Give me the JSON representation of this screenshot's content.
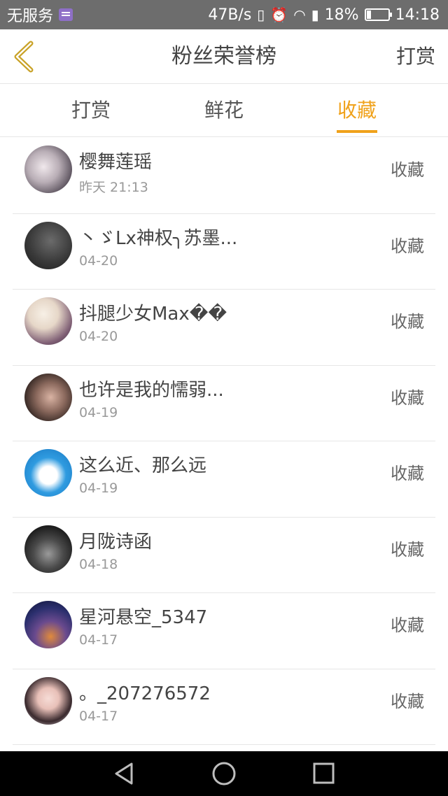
{
  "status_bar": {
    "carrier": "无服务",
    "speed": "47B/s",
    "battery": "18%",
    "time": "14:18"
  },
  "header": {
    "title": "粉丝荣誉榜",
    "right_action": "打赏"
  },
  "tabs": [
    {
      "label": "打赏",
      "active": false
    },
    {
      "label": "鲜花",
      "active": false
    },
    {
      "label": "收藏",
      "active": true
    }
  ],
  "accent_color": "#f0a21b",
  "list": [
    {
      "name": "樱舞莲瑶",
      "date": "昨天 21:13",
      "action": "收藏"
    },
    {
      "name": "丶ゞLx神权╮苏墨...",
      "date": "04-20",
      "action": "收藏"
    },
    {
      "name": "抖腿少女Max��",
      "date": "04-20",
      "action": "收藏"
    },
    {
      "name": "也许是我的懦弱...",
      "date": "04-19",
      "action": "收藏"
    },
    {
      "name": "这么近、那么远",
      "date": "04-19",
      "action": "收藏"
    },
    {
      "name": "月陇诗函",
      "date": "04-18",
      "action": "收藏"
    },
    {
      "name": "星河悬空_5347",
      "date": "04-17",
      "action": "收藏"
    },
    {
      "name": "。_207276572",
      "date": "04-17",
      "action": "收藏"
    }
  ],
  "icons": {
    "back": "back-chevron-icon",
    "nav_back": "nav-back-icon",
    "nav_home": "nav-home-icon",
    "nav_recents": "nav-recents-icon"
  }
}
